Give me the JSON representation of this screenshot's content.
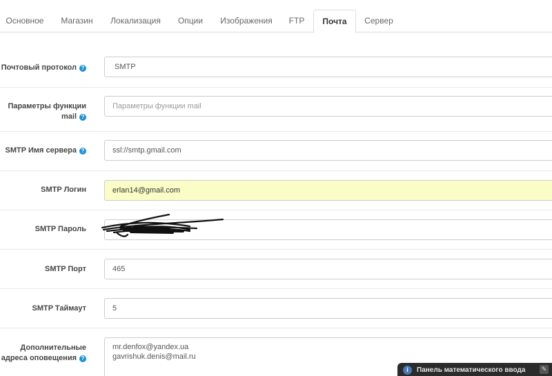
{
  "tabs": [
    {
      "label": "Основное",
      "active": false
    },
    {
      "label": "Магазин",
      "active": false
    },
    {
      "label": "Локализация",
      "active": false
    },
    {
      "label": "Опции",
      "active": false
    },
    {
      "label": "Изображения",
      "active": false
    },
    {
      "label": "FTP",
      "active": false
    },
    {
      "label": "Почта",
      "active": true
    },
    {
      "label": "Сервер",
      "active": false
    }
  ],
  "form": {
    "protocol": {
      "label": "Почтовый протокол",
      "value": "SMTP"
    },
    "mail_params": {
      "label_line1": "Параметры функции",
      "label_line2": "mail",
      "placeholder": "Параметры функции mail"
    },
    "smtp_host": {
      "label": "SMTP Имя сервера",
      "value": "ssl://smtp.gmail.com"
    },
    "smtp_login": {
      "label": "SMTP Логин",
      "value": "erlan14@gmail.com"
    },
    "smtp_password": {
      "label": "SMTP Пароль"
    },
    "smtp_port": {
      "label": "SMTP Порт",
      "value": "465"
    },
    "smtp_timeout": {
      "label": "SMTP Таймаут",
      "value": "5"
    },
    "extra_emails": {
      "label_line1": "Дополнительные",
      "label_line2": "адреса оповещения",
      "line1": "mr.denfox@yandex.ua",
      "line2": "gavrishuk.denis@mail.ru"
    }
  },
  "help_icon_glyph": "?",
  "math_panel": {
    "title": "Панель математического ввода",
    "info_glyph": "i",
    "tool_glyph": "✎"
  }
}
